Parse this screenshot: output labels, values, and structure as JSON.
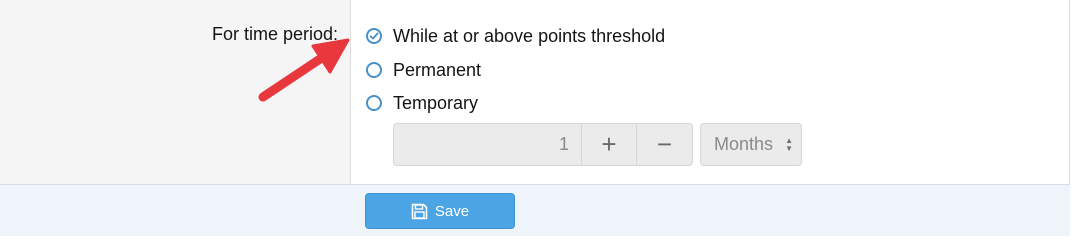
{
  "form": {
    "label": "For time period:",
    "options": [
      {
        "label": "While at or above points threshold",
        "checked": true
      },
      {
        "label": "Permanent",
        "checked": false
      },
      {
        "label": "Temporary",
        "checked": false
      }
    ],
    "duration": {
      "value": "1",
      "increment_glyph": "+",
      "decrement_glyph": "−",
      "unit": "Months"
    }
  },
  "footer": {
    "save_label": "Save",
    "save_icon": "floppy-disk-icon"
  },
  "annotation": {
    "icon": "red-arrow",
    "color": "#e8383d"
  },
  "colors": {
    "accent": "#4ba5e4",
    "radio": "#4a90c8",
    "footer_bg": "#eef4fa"
  }
}
